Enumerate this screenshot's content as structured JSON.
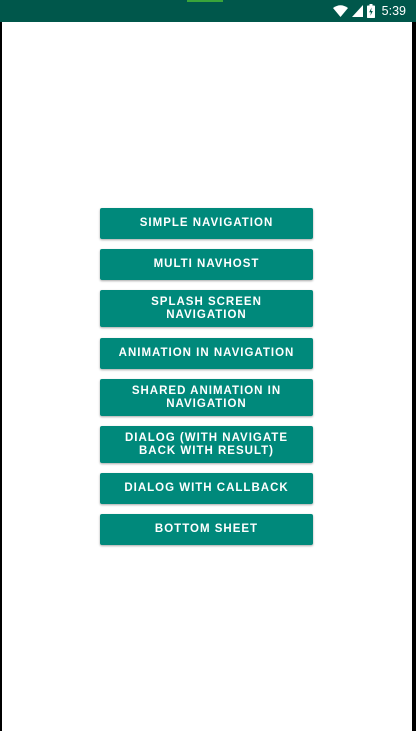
{
  "status_bar": {
    "time": "5:39",
    "wifi_icon": "wifi-icon",
    "signal_icon": "cell-signal-icon",
    "battery_icon": "battery-charging-icon",
    "color": "#00574b"
  },
  "main": {
    "buttons": [
      {
        "label": "SIMPLE NAVIGATION"
      },
      {
        "label": "MULTI NAVHOST"
      },
      {
        "label": "SPLASH SCREEN\nNAVIGATION"
      },
      {
        "label": "ANIMATION IN NAVIGATION"
      },
      {
        "label": "SHARED ANIMATION IN\nNAVIGATION"
      },
      {
        "label": "DIALOG (WITH NAVIGATE\nBACK WITH RESULT)"
      },
      {
        "label": "DIALOG WITH CALLBACK"
      },
      {
        "label": "BOTTOM SHEET"
      }
    ],
    "button_color": "#00897b"
  }
}
